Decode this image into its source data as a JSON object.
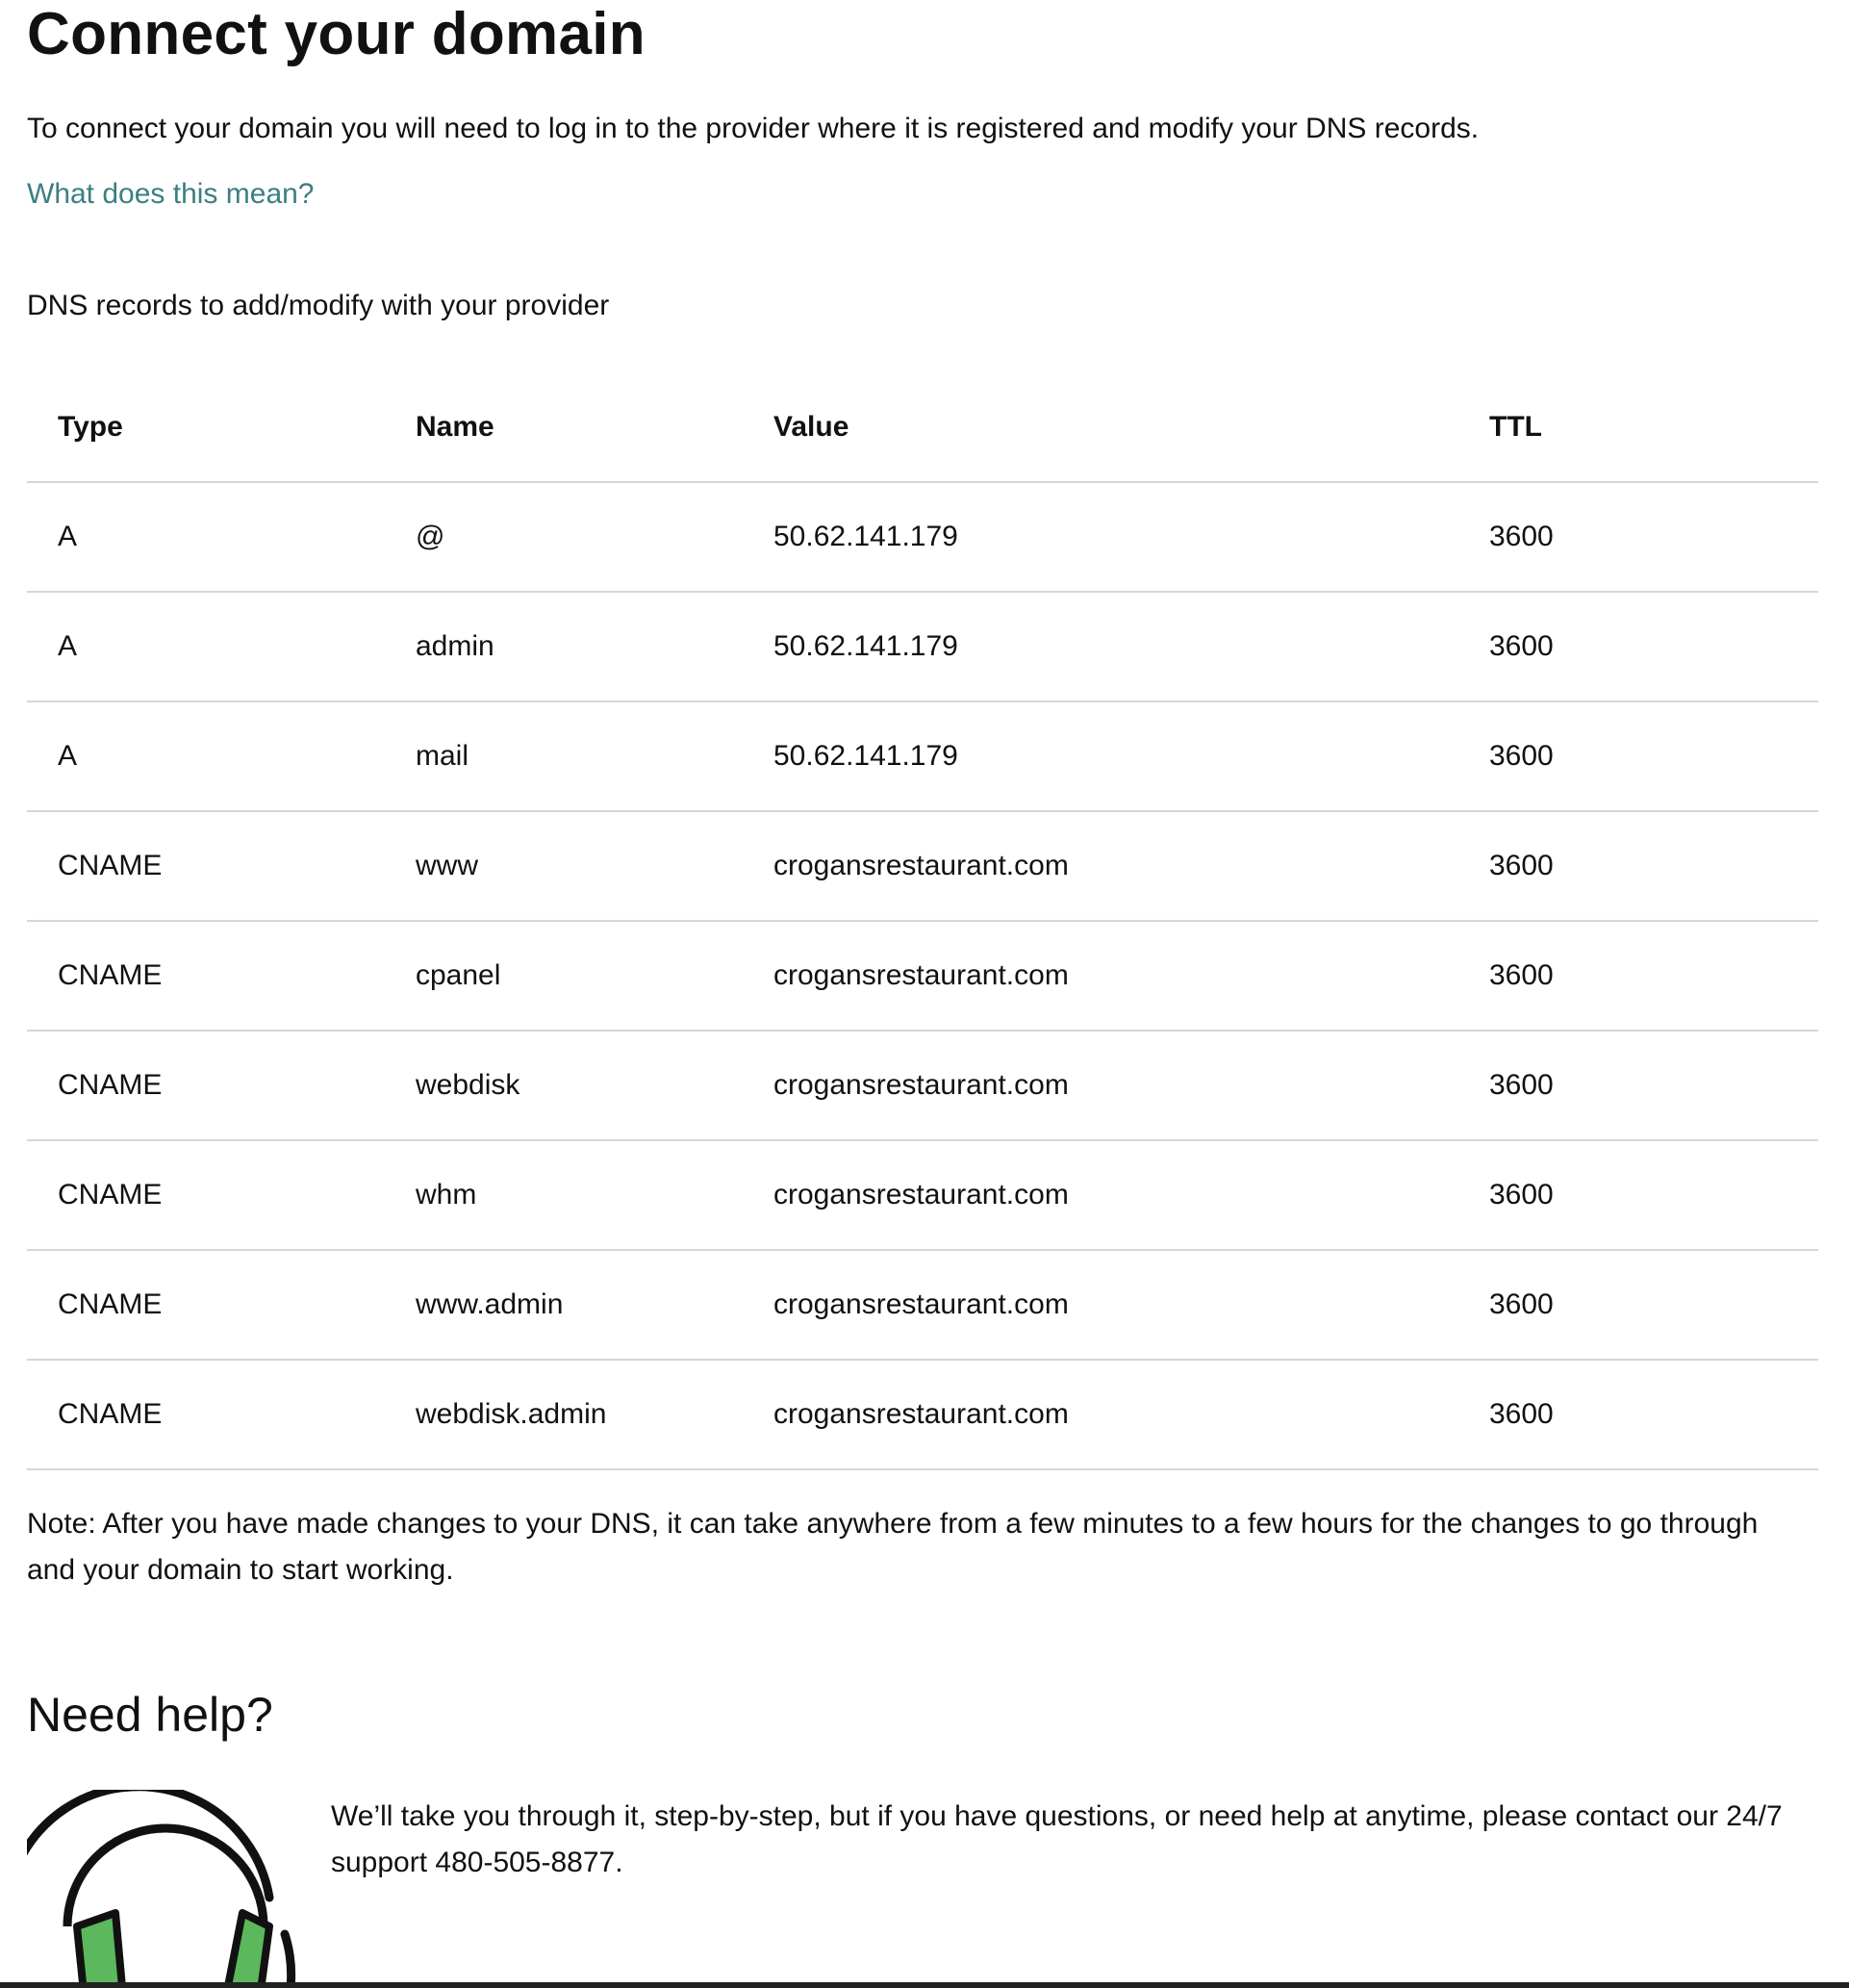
{
  "page": {
    "title": "Connect your domain",
    "intro": "To connect your domain you will need to log in to the provider where it is registered and modify your DNS records.",
    "help_link": "What does this mean?",
    "section_label": "DNS records to add/modify with your provider"
  },
  "table": {
    "headers": {
      "type": "Type",
      "name": "Name",
      "value": "Value",
      "ttl": "TTL"
    },
    "rows": [
      {
        "type": "A",
        "name": "@",
        "value": "50.62.141.179",
        "ttl": "3600"
      },
      {
        "type": "A",
        "name": "admin",
        "value": "50.62.141.179",
        "ttl": "3600"
      },
      {
        "type": "A",
        "name": "mail",
        "value": "50.62.141.179",
        "ttl": "3600"
      },
      {
        "type": "CNAME",
        "name": "www",
        "value": "crogansrestaurant.com",
        "ttl": "3600"
      },
      {
        "type": "CNAME",
        "name": "cpanel",
        "value": "crogansrestaurant.com",
        "ttl": "3600"
      },
      {
        "type": "CNAME",
        "name": "webdisk",
        "value": "crogansrestaurant.com",
        "ttl": "3600"
      },
      {
        "type": "CNAME",
        "name": "whm",
        "value": "crogansrestaurant.com",
        "ttl": "3600"
      },
      {
        "type": "CNAME",
        "name": "www.admin",
        "value": "crogansrestaurant.com",
        "ttl": "3600"
      },
      {
        "type": "CNAME",
        "name": "webdisk.admin",
        "value": "crogansrestaurant.com",
        "ttl": "3600"
      }
    ]
  },
  "note": "Note: After you have made changes to your DNS, it can take anywhere from a few minutes to a few hours for the changes to go through and your domain to start working.",
  "help": {
    "heading": "Need help?",
    "text": "We’ll take you through it, step-by-step, but if you have questions, or need help at anytime, please contact our 24/7 support 480-505-8877.",
    "icon": "headset-icon"
  },
  "colors": {
    "link": "#3b7f82",
    "divider": "#d6d6d6",
    "headset_accent": "#5cb85c"
  }
}
